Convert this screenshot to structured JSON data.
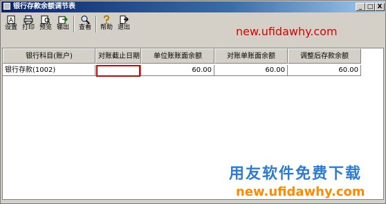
{
  "window": {
    "title": "银行存款余额调节表",
    "minimize_label": "_",
    "maximize_label": "□",
    "close_label": "X"
  },
  "toolbar": {
    "buttons": [
      {
        "label": "设置",
        "icon": "settings-icon"
      },
      {
        "label": "打印",
        "icon": "printer-icon"
      },
      {
        "label": "预览",
        "icon": "preview-icon"
      },
      {
        "label": "输出",
        "icon": "export-icon"
      },
      {
        "label": "查看",
        "icon": "search-icon"
      },
      {
        "label": "帮助",
        "icon": "help-icon"
      },
      {
        "label": "退出",
        "icon": "exit-icon"
      }
    ]
  },
  "watermark": {
    "top_url": "new.ufidawhy.com",
    "bottom_text": "用友软件免费下载",
    "bottom_url": "new.ufidawhy.com"
  },
  "table": {
    "columns": [
      "银行科目(账户)",
      "对账截止日期",
      "单位账账面余额",
      "对账单账面余额",
      "调整后存款余额"
    ],
    "rows": [
      {
        "account": "银行存款(1002)",
        "cutoff_date": "",
        "book_balance": "60.00",
        "statement_balance": "60.00",
        "adjusted_balance": "60.00"
      }
    ]
  },
  "colors": {
    "titlebar_start": "#0a246a",
    "highlight_border": "#e00000",
    "watermark_red": "#d90000",
    "watermark_blue": "#2b7bd6",
    "watermark_orange": "#ff8a00"
  }
}
